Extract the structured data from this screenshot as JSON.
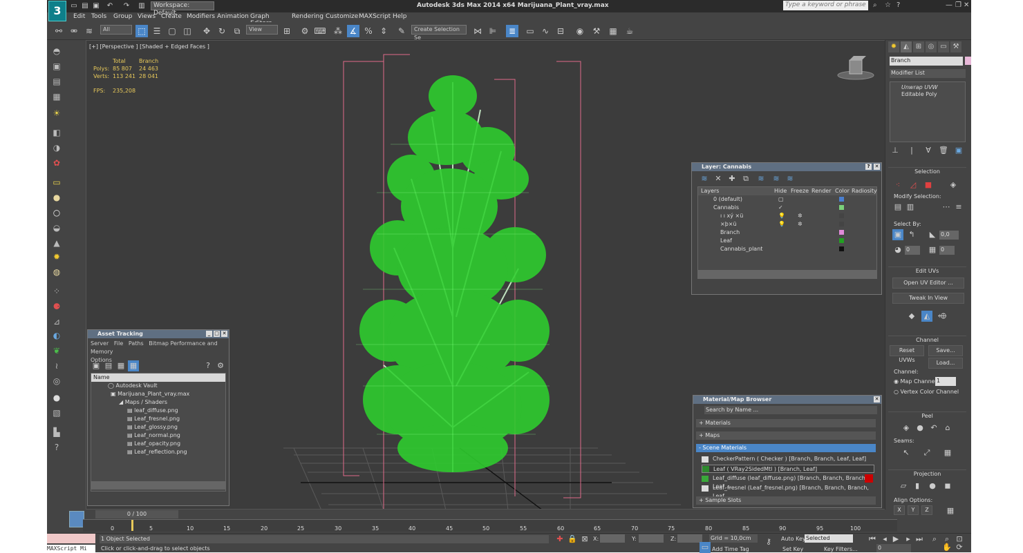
{
  "app": {
    "title": "Autodesk 3ds Max  2014 x64     Marijuana_Plant_vray.max",
    "workspace": "Workspace: Default",
    "search_placeholder": "Type a keyword or phrase"
  },
  "menu": [
    "Edit",
    "Tools",
    "Group",
    "Views",
    "Create",
    "Modifiers",
    "Animation",
    "Graph Editors",
    "Rendering",
    "Customize",
    "MAXScript",
    "Help"
  ],
  "toolbar": {
    "selection_filter": "All",
    "coord_system": "View",
    "named_selection": "Create Selection Se"
  },
  "viewport": {
    "label": "[+] [Perspective ] [Shaded + Edged Faces ]",
    "stats": {
      "col_total": "Total",
      "col_branch": "Branch",
      "polys_label": "Polys:",
      "polys_total": "85 807",
      "polys_branch": "24 463",
      "verts_label": "Verts:",
      "verts_total": "113 241",
      "verts_branch": "28 041",
      "fps_label": "FPS:",
      "fps_value": "235,208"
    }
  },
  "command_panel": {
    "object_name": "Branch",
    "modifier_list": "Modifier List",
    "stack": [
      "Unwrap UVW",
      "Editable Poly"
    ],
    "selection_title": "Selection",
    "modify_selection": "Modify Selection:",
    "select_by": "Select By:",
    "spinner_a": "0,0",
    "spinner_b": "0",
    "spinner_c": "0",
    "edit_uvs_title": "Edit UVs",
    "open_uv_editor": "Open UV Editor ...",
    "tweak_in_view": "Tweak In View",
    "channel_title": "Channel",
    "reset_uvws": "Reset UVWs",
    "save": "Save...",
    "load": "Load...",
    "channel_label": "Channel:",
    "map_channel": "Map Channel:",
    "map_channel_value": "1",
    "vertex_color_channel": "Vertex Color Channel",
    "peel_title": "Peel",
    "seams_label": "Seams:",
    "projection_title": "Projection",
    "align_options": "Align Options:",
    "align_x": "X",
    "align_y": "Y",
    "align_z": "Z"
  },
  "layer_window": {
    "title": "Layer: Cannabis",
    "headers": [
      "Layers",
      "Hide",
      "Freeze",
      "Render",
      "Color",
      "Radiosity"
    ],
    "rows": [
      {
        "name": "0 (default)",
        "color": "#4a7fd0"
      },
      {
        "name": "Cannabis",
        "color": "#7ad07a"
      },
      {
        "name": "ı ı xý ×ü",
        "color": "#444444"
      },
      {
        "name": "×þ×ü",
        "color": "#444444"
      },
      {
        "name": "Branch",
        "color": "#e08ad8"
      },
      {
        "name": "Leaf",
        "color": "#22a022"
      },
      {
        "name": "Cannabis_plant",
        "color": "#111111"
      }
    ]
  },
  "asset_window": {
    "title": "Asset Tracking",
    "menu": [
      "Server",
      "File",
      "Paths",
      "Bitmap Performance and Memory",
      "Options"
    ],
    "column": "Name",
    "rows": [
      "Autodesk Vault",
      "Marijuana_Plant_vray.max",
      "Maps / Shaders",
      "leaf_diffuse.png",
      "Leaf_fresnel.png",
      "Leaf_glossy.png",
      "Leaf_normal.png",
      "Leaf_opacity.png",
      "Leaf_reflection.png"
    ]
  },
  "material_window": {
    "title": "Material/Map Browser",
    "search": "Search by Name ...",
    "groups": [
      "+ Materials",
      "+ Maps",
      "- Scene Materials"
    ],
    "items": [
      "CheckerPattern  ( Checker ) [Branch, Branch, Leaf, Leaf]",
      "Leaf  ( VRay2SidedMtl ) [Branch, Leaf]",
      "Leaf_diffuse (leaf_diffuse.png)  [Branch, Branch, Branch, Leaf,...",
      "Leaf_fresnel (Leaf_fresnel.png)  [Branch, Branch, Branch, Leaf,..."
    ],
    "sample_slots": "+ Sample Slots"
  },
  "timeline": {
    "frame": "0 / 100",
    "ticks": [
      "0",
      "5",
      "10",
      "15",
      "20",
      "25",
      "30",
      "35",
      "40",
      "45",
      "50",
      "55",
      "60",
      "65",
      "70",
      "75",
      "80",
      "85",
      "90",
      "95",
      "100"
    ]
  },
  "status": {
    "maxscript": "MAXScript Mi",
    "selected": "1 Object Selected",
    "prompt": "Click or click-and-drag to select objects",
    "x_label": "X:",
    "y_label": "Y:",
    "z_label": "Z:",
    "grid": "Grid = 10,0cm",
    "auto_key": "Auto Key",
    "selected_dd": "Selected",
    "set_key": "Set Key",
    "key_filters": "Key Filters...",
    "add_time_tag": "Add Time Tag",
    "frame_field": "0"
  },
  "colors": {
    "accent": "#4a86c7",
    "stats": "#e8c95a",
    "leaf": "#2ecf2e",
    "bbox": "#e06a8a"
  }
}
